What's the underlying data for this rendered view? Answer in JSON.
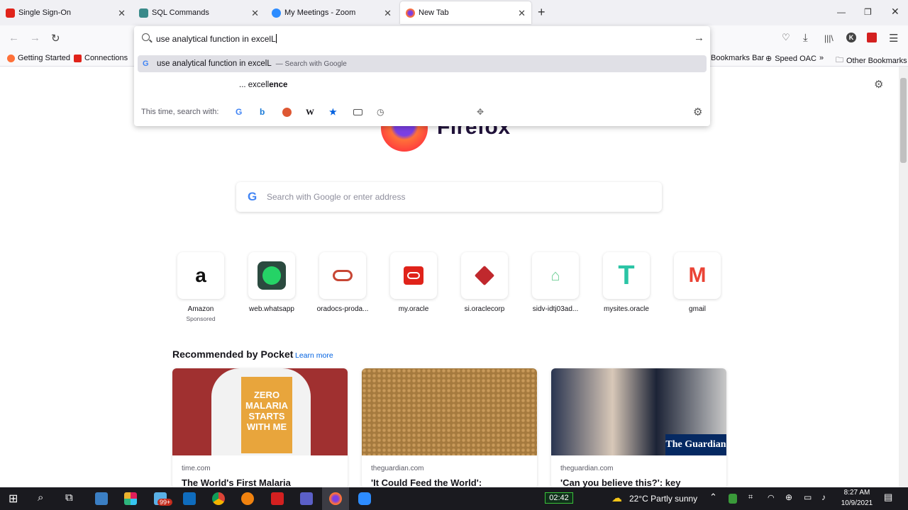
{
  "tabs": [
    {
      "title": "Single Sign-On",
      "icon": "oracle-icon",
      "color": "#e0231a"
    },
    {
      "title": "SQL Commands",
      "icon": "sql-icon",
      "color": "#3a8a8a"
    },
    {
      "title": "My Meetings - Zoom",
      "icon": "zoom-icon",
      "color": "#2d8cff"
    },
    {
      "title": "New Tab",
      "icon": "firefox-icon",
      "color": "#ff7139"
    }
  ],
  "urlbar": {
    "value": "use analytical function in excelL",
    "suggestion_primary": "use analytical function in excelL",
    "suggestion_primary_sub": "— Search with Google",
    "suggestion_secondary_prefix": "... excell",
    "suggestion_secondary_bold": "ence",
    "oneoff_label": "This time, search with:"
  },
  "bookmarks": {
    "getting_started": "Getting Started",
    "connections": "Connections",
    "bookmarks_bar": "Bookmarks Bar",
    "speed_oac": "Speed OAC",
    "other": "Other Bookmarks"
  },
  "brand": {
    "wordmark": "Firefox"
  },
  "search": {
    "placeholder": "Search with Google or enter address"
  },
  "top_sites": [
    {
      "label": "Amazon",
      "sub": "Sponsored"
    },
    {
      "label": "web.whatsapp"
    },
    {
      "label": "oradocs-proda..."
    },
    {
      "label": "my.oracle"
    },
    {
      "label": "si.oraclecorp"
    },
    {
      "label": "sidv-idtj03ad..."
    },
    {
      "label": "mysites.oracle"
    },
    {
      "label": "gmail"
    }
  ],
  "pocket": {
    "heading": "Recommended by Pocket",
    "learn_more": "Learn more",
    "cards": [
      {
        "source": "time.com",
        "title": "The World's First Malaria"
      },
      {
        "source": "theguardian.com",
        "title": "'It Could Feed the World':"
      },
      {
        "source": "theguardian.com",
        "title": "'Can you believe this?': key"
      }
    ],
    "card1_shirt": "ZERO MALARIA STARTS WITH ME",
    "card3_badge": "The Guardian"
  },
  "taskbar": {
    "badge": "99+",
    "timer": "02:42",
    "weather": "22°C  Partly sunny",
    "time": "8:27 AM",
    "date": "10/9/2021"
  }
}
